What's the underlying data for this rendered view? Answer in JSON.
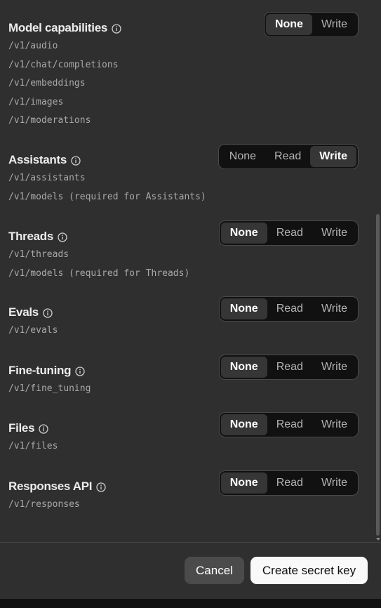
{
  "sections": [
    {
      "title": "Model capabilities",
      "options": [
        "None",
        "Write"
      ],
      "selected": "None",
      "endpoints": [
        "/v1/audio",
        "/v1/chat/completions",
        "/v1/embeddings",
        "/v1/images",
        "/v1/moderations"
      ]
    },
    {
      "title": "Assistants",
      "options": [
        "None",
        "Read",
        "Write"
      ],
      "selected": "Write",
      "endpoints": [
        "/v1/assistants",
        "/v1/models (required for Assistants)"
      ]
    },
    {
      "title": "Threads",
      "options": [
        "None",
        "Read",
        "Write"
      ],
      "selected": "None",
      "endpoints": [
        "/v1/threads",
        "/v1/models (required for Threads)"
      ]
    },
    {
      "title": "Evals",
      "options": [
        "None",
        "Read",
        "Write"
      ],
      "selected": "None",
      "endpoints": [
        "/v1/evals"
      ]
    },
    {
      "title": "Fine-tuning",
      "options": [
        "None",
        "Read",
        "Write"
      ],
      "selected": "None",
      "endpoints": [
        "/v1/fine_tuning"
      ]
    },
    {
      "title": "Files",
      "options": [
        "None",
        "Read",
        "Write"
      ],
      "selected": "None",
      "endpoints": [
        "/v1/files"
      ]
    },
    {
      "title": "Responses API",
      "options": [
        "None",
        "Read",
        "Write"
      ],
      "selected": "None",
      "endpoints": [
        "/v1/responses"
      ]
    }
  ],
  "footer": {
    "cancel_label": "Cancel",
    "create_label": "Create secret key"
  },
  "icons": {
    "info": "info-circle-icon"
  },
  "colors": {
    "panel_bg": "#2f2f2f",
    "active_segment": "#363636",
    "primary_button": "#f9f9f9"
  }
}
